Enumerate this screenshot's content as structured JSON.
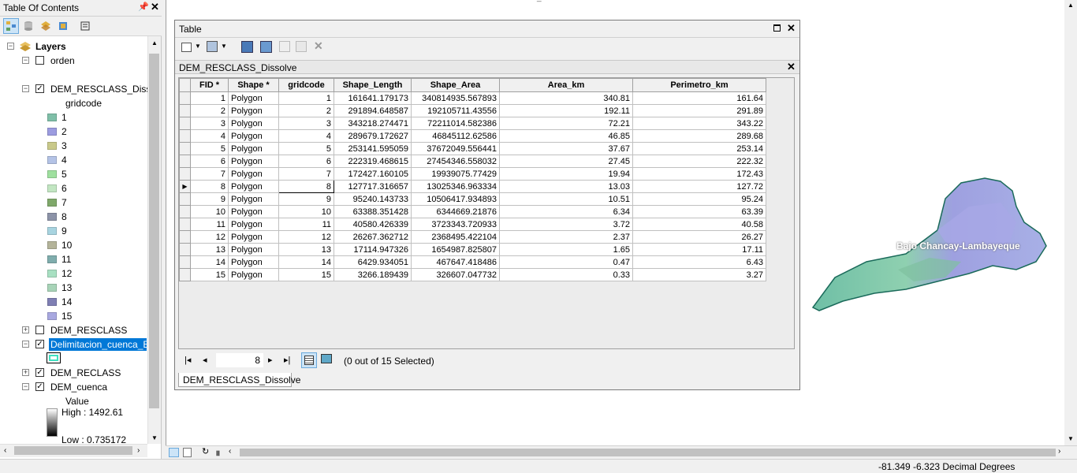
{
  "toc": {
    "title": "Table Of Contents",
    "pin_icon": "pin-icon",
    "close_label": "✕",
    "tree": {
      "layers_label": "Layers",
      "orden": "orden",
      "dissolve_label": "DEM_RESCLASS_Dissolve",
      "gridcode_label": "gridcode",
      "classes": [
        {
          "label": "1",
          "color": "#7fbfa8"
        },
        {
          "label": "2",
          "color": "#9c9ce0"
        },
        {
          "label": "3",
          "color": "#c9c98a"
        },
        {
          "label": "4",
          "color": "#b4c3e6"
        },
        {
          "label": "5",
          "color": "#9fe09f"
        },
        {
          "label": "6",
          "color": "#c2e6c2"
        },
        {
          "label": "7",
          "color": "#7fa86a"
        },
        {
          "label": "8",
          "color": "#8c93a8"
        },
        {
          "label": "9",
          "color": "#a8d4e0"
        },
        {
          "label": "10",
          "color": "#b4b49a"
        },
        {
          "label": "11",
          "color": "#7fadad"
        },
        {
          "label": "12",
          "color": "#a8e0c2"
        },
        {
          "label": "13",
          "color": "#a8d4b8"
        },
        {
          "label": "14",
          "color": "#7f7fb4"
        },
        {
          "label": "15",
          "color": "#a8a8e0"
        }
      ],
      "resclass_label": "DEM_RESCLASS",
      "delimitacion_label": "Delimitacion_cuenca_B",
      "reclass_label": "DEM_RECLASS",
      "cuenca_label": "DEM_cuenca",
      "value_label": "Value",
      "high_label": "High : 1492.61",
      "low_label": "Low : 0.735172"
    }
  },
  "table_window": {
    "title": "Table",
    "table_name": "DEM_RESCLASS_Dissolve",
    "columns": [
      "FID *",
      "Shape *",
      "gridcode",
      "Shape_Length",
      "Shape_Area",
      "Area_km",
      "Perimetro_km"
    ],
    "rows": [
      [
        "1",
        "Polygon",
        "1",
        "161641.179173",
        "340814935.567893",
        "340.81",
        "161.64"
      ],
      [
        "2",
        "Polygon",
        "2",
        "291894.648587",
        "192105711.43556",
        "192.11",
        "291.89"
      ],
      [
        "3",
        "Polygon",
        "3",
        "343218.274471",
        "72211014.582386",
        "72.21",
        "343.22"
      ],
      [
        "4",
        "Polygon",
        "4",
        "289679.172627",
        "46845112.62586",
        "46.85",
        "289.68"
      ],
      [
        "5",
        "Polygon",
        "5",
        "253141.595059",
        "37672049.556441",
        "37.67",
        "253.14"
      ],
      [
        "6",
        "Polygon",
        "6",
        "222319.468615",
        "27454346.558032",
        "27.45",
        "222.32"
      ],
      [
        "7",
        "Polygon",
        "7",
        "172427.160105",
        "19939075.77429",
        "19.94",
        "172.43"
      ],
      [
        "8",
        "Polygon",
        "8",
        "127717.316657",
        "13025346.963334",
        "13.03",
        "127.72"
      ],
      [
        "9",
        "Polygon",
        "9",
        "95240.143733",
        "10506417.934893",
        "10.51",
        "95.24"
      ],
      [
        "10",
        "Polygon",
        "10",
        "63388.351428",
        "6344669.21876",
        "6.34",
        "63.39"
      ],
      [
        "11",
        "Polygon",
        "11",
        "40580.426339",
        "3723343.720933",
        "3.72",
        "40.58"
      ],
      [
        "12",
        "Polygon",
        "12",
        "26267.362712",
        "2368495.422104",
        "2.37",
        "26.27"
      ],
      [
        "13",
        "Polygon",
        "13",
        "17114.947326",
        "1654987.825807",
        "1.65",
        "17.11"
      ],
      [
        "14",
        "Polygon",
        "14",
        "6429.934051",
        "467647.418486",
        "0.47",
        "6.43"
      ],
      [
        "15",
        "Polygon",
        "15",
        "3266.189439",
        "326607.047732",
        "0.33",
        "3.27"
      ]
    ],
    "current_record": "8",
    "selection_status": "(0 out of 15 Selected)",
    "bottom_tab": "DEM_RESCLASS_Dissolve"
  },
  "map": {
    "label": "Bajo Chancay-Lambayeque"
  },
  "status": {
    "coords": "-81.349  -6.323 Decimal Degrees"
  }
}
